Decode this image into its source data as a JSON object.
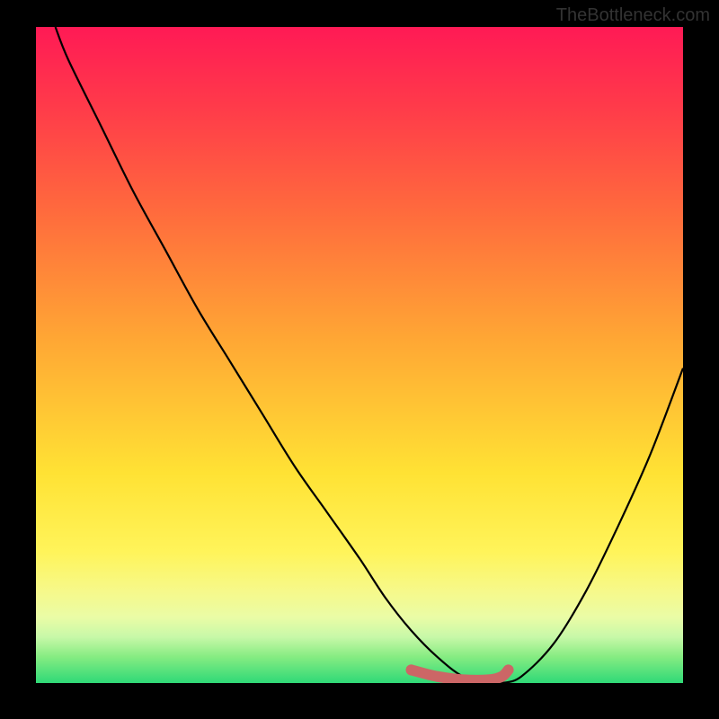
{
  "attribution": "TheBottleneck.com",
  "chart_data": {
    "type": "line",
    "title": "",
    "xlabel": "",
    "ylabel": "",
    "xlim": [
      0,
      100
    ],
    "ylim": [
      0,
      100
    ],
    "series": [
      {
        "name": "bottleneck-curve",
        "x": [
          3,
          5,
          10,
          15,
          20,
          25,
          30,
          35,
          40,
          45,
          50,
          54,
          58,
          62,
          66,
          70,
          72,
          75,
          80,
          85,
          90,
          95,
          100
        ],
        "y": [
          100,
          95,
          85,
          75,
          66,
          57,
          49,
          41,
          33,
          26,
          19,
          13,
          8,
          4,
          1,
          0,
          0,
          1,
          6,
          14,
          24,
          35,
          48
        ]
      },
      {
        "name": "optimal-region",
        "x": [
          58,
          62,
          66,
          70,
          72,
          73
        ],
        "y": [
          2,
          1,
          0.5,
          0.5,
          1,
          2
        ]
      }
    ],
    "gradient_stops": [
      {
        "pos": 0.0,
        "color": "#ff1a55"
      },
      {
        "pos": 0.12,
        "color": "#ff3a4a"
      },
      {
        "pos": 0.28,
        "color": "#ff6a3d"
      },
      {
        "pos": 0.48,
        "color": "#ffa834"
      },
      {
        "pos": 0.68,
        "color": "#ffe234"
      },
      {
        "pos": 0.8,
        "color": "#fff45a"
      },
      {
        "pos": 0.86,
        "color": "#f6f98a"
      },
      {
        "pos": 0.9,
        "color": "#eafca6"
      },
      {
        "pos": 0.93,
        "color": "#c7f8a8"
      },
      {
        "pos": 0.96,
        "color": "#86ec82"
      },
      {
        "pos": 1.0,
        "color": "#2fd977"
      }
    ]
  }
}
